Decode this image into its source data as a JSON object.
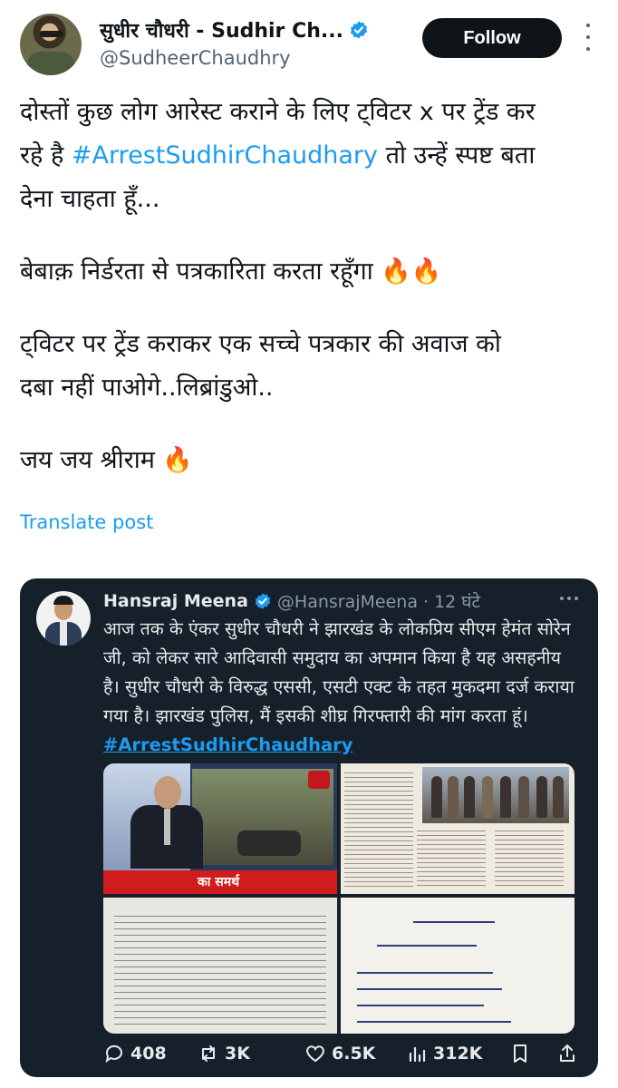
{
  "author": {
    "display_name": "सुधीर चौधरी - Sudhir Ch...",
    "handle": "@SudheerChaudhry",
    "verified": true
  },
  "follow_label": "Follow",
  "post": {
    "line1": "दोस्तों कुछ लोग आरेस्ट कराने के लिए ट्विटर x पर ट्रेंड कर",
    "line2_before": "रहे है ",
    "line2_hashtag": "#ArrestSudhirChaudhary",
    "line2_after": " तो उन्हें स्पष्ट बता",
    "line3": "देना चाहता हूँ...",
    "para2": "बेबाक़ निर्डरता से पत्रकारिता करता रहूँगा 🔥🔥",
    "para3_line1": "ट्विटर पर ट्रेंड कराकर एक सच्चे पत्रकार की अवाज को",
    "para3_line2": "दबा नहीं पाओगे..लिब्रांडुओ..",
    "para4": "जय जय श्रीराम 🔥"
  },
  "translate_label": "Translate post",
  "quoted": {
    "display_name": "Hansraj Meena",
    "handle_time": "@HansrajMeena · 12 घंटे",
    "verified": true,
    "text": "आज तक के एंकर सुधीर चौधरी ने झारखंड के लोकप्रिय सीएम हेमंत सोरेन जी, को लेकर सारे आदिवासी समुदाय का अपमान किया है यह असहनीय है। सुधीर चौधरी के विरुद्ध एससी, एसटी एक्ट के तहत मुकदमा दर्ज कराया गया है। झारखंड पुलिस, मैं इसकी शीघ्र गिरफ्तारी की मांग करता हूं।",
    "hashtag": "#ArrestSudhirChaudhary",
    "media_caption": "का समर्थ",
    "stats": {
      "replies": "408",
      "reposts": "3K",
      "likes": "6.5K",
      "views": "312K"
    }
  },
  "icons": [
    "verified-badge-icon",
    "more-options-icon",
    "reply-icon",
    "repost-icon",
    "like-icon",
    "views-icon",
    "bookmark-icon",
    "share-icon"
  ],
  "colors": {
    "accent": "#1d9bf0",
    "follow_bg": "#0f1419",
    "quote_bg": "#15202b"
  }
}
